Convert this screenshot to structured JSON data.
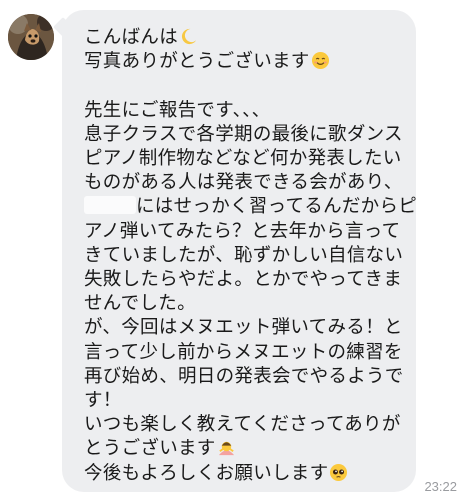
{
  "message": {
    "lines": [
      "こんばんは",
      "写真ありがとうございます",
      "",
      "先生にご報告です、、、",
      "息子クラスで各学期の最後に歌ダンス",
      "ピアノ制作物などなど何か発表したい",
      "ものがある人は発表できる会があり、",
      "にはせっかく習ってるんだからピ",
      "アノ弾いてみたら？と去年から言って",
      "きていましたが、恥ずかしい自信ない",
      "失敗したらやだよ。とかでやってきま",
      "せんでした。",
      "が、今回はメヌエット弾いてみる！と",
      "言って少し前からメヌエットの練習を",
      "再び始め、明日の発表会でやるようで",
      "す！",
      "いつも楽しく教えてくださってありが",
      "とうございます",
      "今後もよろしくお願いします"
    ],
    "emoji": {
      "line0": "crescent-moon-emoji",
      "line1": "smiling-face-emoji",
      "line17": "bowing-person-emoji",
      "line18": "pleading-face-emoji"
    }
  },
  "timestamp": "23:22",
  "colors": {
    "bubble": "#edeef0",
    "text": "#1a1a1a",
    "timestamp": "#9a9ca0"
  }
}
